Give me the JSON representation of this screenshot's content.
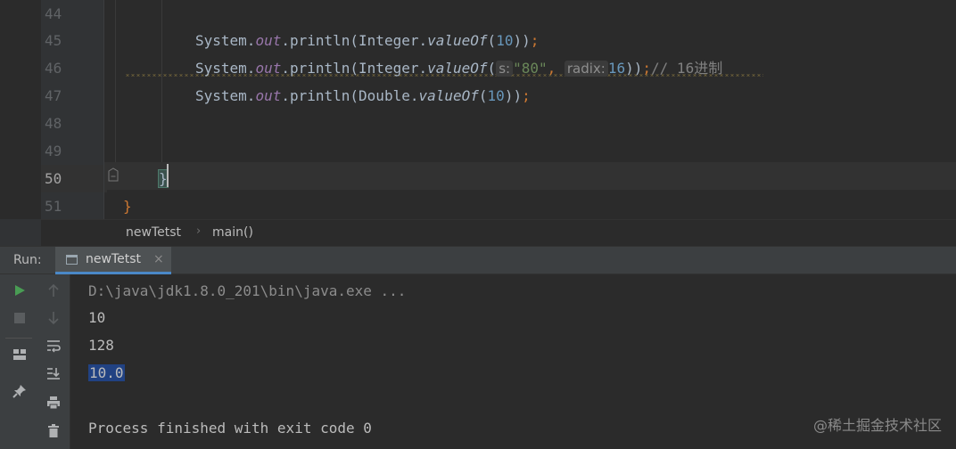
{
  "editor": {
    "line_numbers": [
      "44",
      "45",
      "46",
      "47",
      "48",
      "49",
      "50",
      "51"
    ],
    "lines": {
      "l45": {
        "p1": "System.",
        "field": "out",
        "p2": ".println(Integer.",
        "method": "valueOf",
        "p3": "(",
        "num": "10",
        "p4": "))",
        "semi": ";"
      },
      "l46": {
        "p1": "System.",
        "field": "out",
        "p2": ".println(Integer.",
        "method": "valueOf",
        "p3": "(",
        "hint1": "s:",
        "str": "\"80\"",
        "comma": ",",
        "hint2": "radix:",
        "num": "16",
        "p4": "))",
        "semi": ";",
        "comment": "// 16进制"
      },
      "l47": {
        "p1": "System.",
        "field": "out",
        "p2": ".println(Double.",
        "method": "valueOf",
        "p3": "(",
        "num": "10",
        "p4": "))",
        "semi": ";"
      },
      "l50": {
        "brace": "}"
      },
      "l51": {
        "brace": "}"
      }
    }
  },
  "breadcrumb": {
    "class_name": "newTetst",
    "separator": "›",
    "method_name": "main()"
  },
  "run": {
    "label": "Run:",
    "tab_label": "newTetst",
    "tab_close": "×",
    "console_lines": [
      "D:\\java\\jdk1.8.0_201\\bin\\java.exe ...",
      "10",
      "128",
      "10.0",
      "",
      "Process finished with exit code 0"
    ]
  },
  "watermark": "@稀土掘金技术社区",
  "colors": {
    "accent": "#4a88c7",
    "selection": "#214283",
    "run_green": "#499c54"
  }
}
